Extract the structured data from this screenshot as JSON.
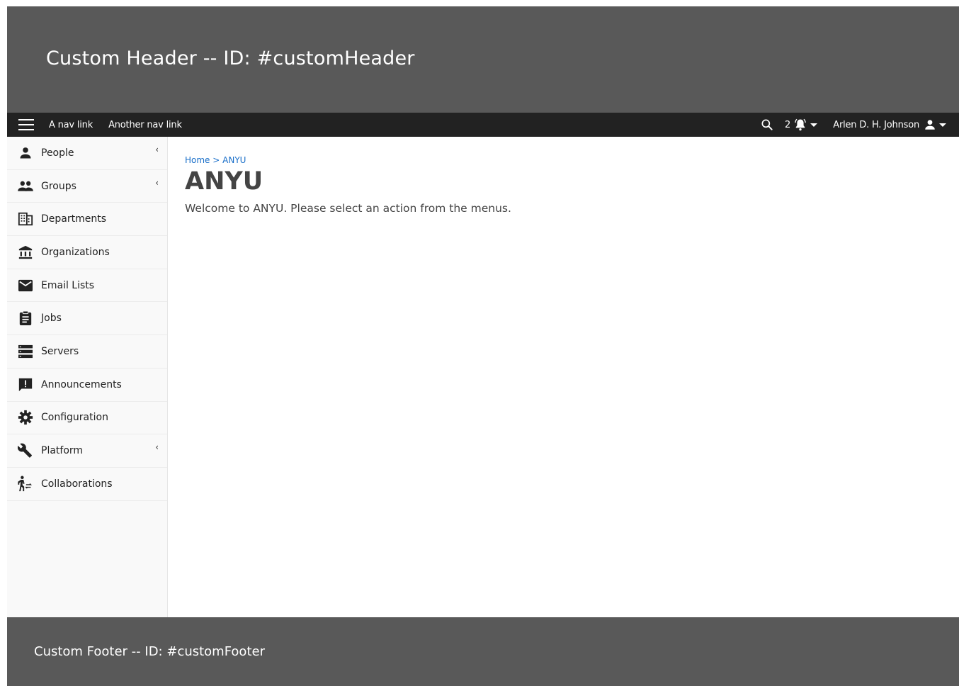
{
  "header": {
    "title": "Custom Header -- ID: #customHeader"
  },
  "navbar": {
    "links": [
      "A nav link",
      "Another nav link"
    ],
    "notification_count": "2",
    "user_name": "Arlen D. H. Johnson"
  },
  "sidebar": {
    "items": [
      {
        "label": "People",
        "icon": "person-icon",
        "submenu": true
      },
      {
        "label": "Groups",
        "icon": "group-icon",
        "submenu": true
      },
      {
        "label": "Departments",
        "icon": "building-icon",
        "submenu": false
      },
      {
        "label": "Organizations",
        "icon": "institution-icon",
        "submenu": false
      },
      {
        "label": "Email Lists",
        "icon": "mail-icon",
        "submenu": false
      },
      {
        "label": "Jobs",
        "icon": "clipboard-icon",
        "submenu": false
      },
      {
        "label": "Servers",
        "icon": "server-icon",
        "submenu": false
      },
      {
        "label": "Announcements",
        "icon": "announcement-icon",
        "submenu": false
      },
      {
        "label": "Configuration",
        "icon": "gear-icon",
        "submenu": false
      },
      {
        "label": "Platform",
        "icon": "wrench-icon",
        "submenu": true
      },
      {
        "label": "Collaborations",
        "icon": "collaboration-icon",
        "submenu": false
      }
    ]
  },
  "main": {
    "breadcrumb": {
      "home": "Home",
      "separator": ">",
      "current": "ANYU"
    },
    "title": "ANYU",
    "welcome": "Welcome to ANYU. Please select an action from the menus."
  },
  "footer": {
    "title": "Custom Footer -- ID: #customFooter"
  },
  "colors": {
    "header_bg": "#595959",
    "navbar_bg": "#222222",
    "link": "#1a6fc9",
    "sidebar_bg": "#f9f9f9"
  }
}
